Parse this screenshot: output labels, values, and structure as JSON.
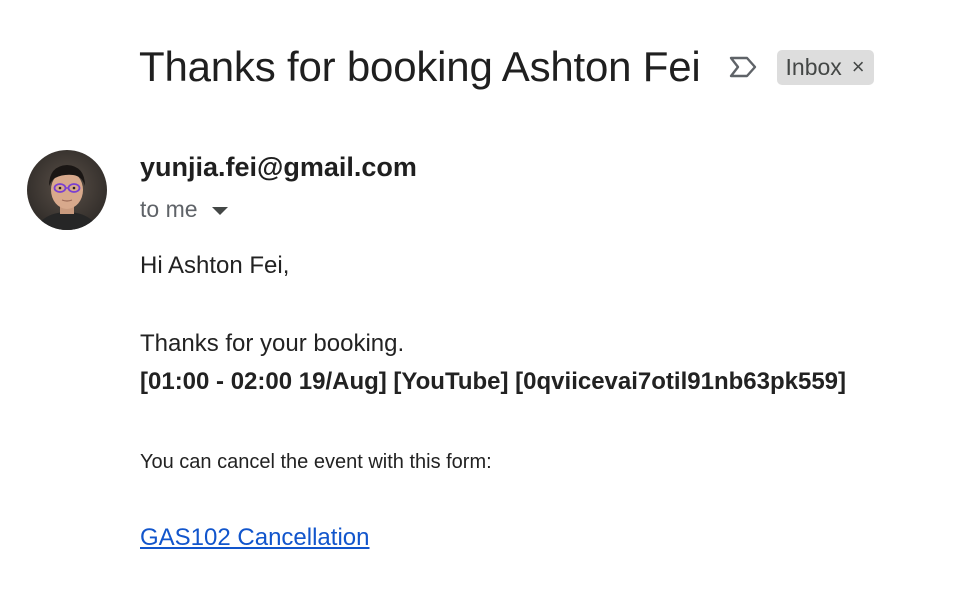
{
  "email": {
    "subject": "Thanks for booking Ashton Fei",
    "label": "Inbox",
    "label_close": "×",
    "sender": "yunjia.fei@gmail.com",
    "recipient": "to me",
    "body": {
      "greeting": "Hi Ashton Fei,",
      "thanks": "Thanks for your booking.",
      "booking_details": "[01:00 - 02:00 19/Aug] [YouTube] [0qviicevai7otil91nb63pk559]",
      "cancel_note": "You can cancel the event with this form:",
      "cancel_link": "GAS102 Cancellation"
    }
  },
  "icons": {
    "important_marker": "label-important-outline-icon",
    "recipient_details": "caret-down-icon",
    "avatar": "sender-avatar-photo"
  },
  "colors": {
    "link": "#1155cc",
    "chip_background": "#dddddd",
    "secondary_text": "#5f6368"
  }
}
